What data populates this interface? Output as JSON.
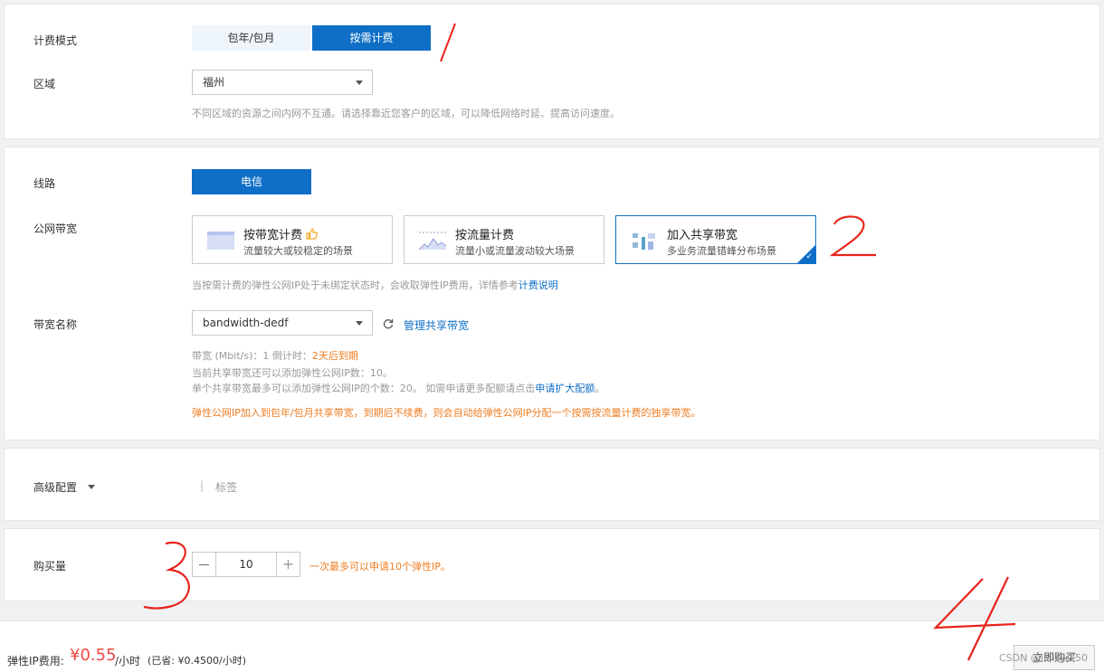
{
  "billing": {
    "label": "计费模式",
    "options": [
      "包年/包月",
      "按需计费"
    ],
    "selected": "按需计费"
  },
  "region": {
    "label": "区域",
    "value": "福州",
    "hint": "不同区域的资源之间内网不互通。请选择靠近您客户的区域，可以降低网络时延、提高访问速度。"
  },
  "line": {
    "label": "线路",
    "value": "电信"
  },
  "bandwidth": {
    "label": "公网带宽",
    "options": [
      {
        "title": "按带宽计费",
        "desc": "流量较大或较稳定的场景",
        "icon": "thumbs-up-icon"
      },
      {
        "title": "按流量计费",
        "desc": "流量小或流量波动较大场景"
      },
      {
        "title": "加入共享带宽",
        "desc": "多业务流量错峰分布场景"
      }
    ],
    "selected": "加入共享带宽",
    "hint_prefix": "当按需计费的弹性公网IP处于未绑定状态时，会收取弹性IP费用，详情参考",
    "hint_link": "计费说明"
  },
  "bw_name": {
    "label": "带宽名称",
    "value": "bandwidth-dedf",
    "manage_link": "管理共享带宽",
    "info_line1_prefix": "带宽 (Mbit/s)：1   倒计时：",
    "info_line1_highlight": "2天后到期",
    "info_line2": "当前共享带宽还可以添加弹性公网IP数：10。",
    "info_line3_prefix": "单个共享带宽最多可以添加弹性公网IP的个数：20。 如需申请更多配额请点击",
    "info_line3_link": "申请扩大配额",
    "info_line3_suffix": "。",
    "warning": "弹性公网IP加入到包年/包月共享带宽，到期后不续费，则会自动给弹性公网IP分配一个按需按流量计费的独享带宽。"
  },
  "advanced": {
    "label": "高级配置",
    "separator": "|",
    "tag": "标签"
  },
  "purchase": {
    "label": "购买量",
    "quantity": "10",
    "minus": "—",
    "plus": "+",
    "hint": "一次最多可以申请10个弹性IP。"
  },
  "footer": {
    "fee_label": "弹性IP费用:",
    "price": "¥0.55",
    "unit": "/小时",
    "saved": "(已省: ¥0.4500/小时)",
    "button": "立即购买",
    "watermark": "CSDN @IMisJk250"
  },
  "annotations": [
    "1",
    "2",
    "3",
    "4"
  ],
  "colors": {
    "accent": "#0f6fc6",
    "price": "#f04844",
    "warning": "#ef7d22",
    "annotation": "#e8231b"
  }
}
